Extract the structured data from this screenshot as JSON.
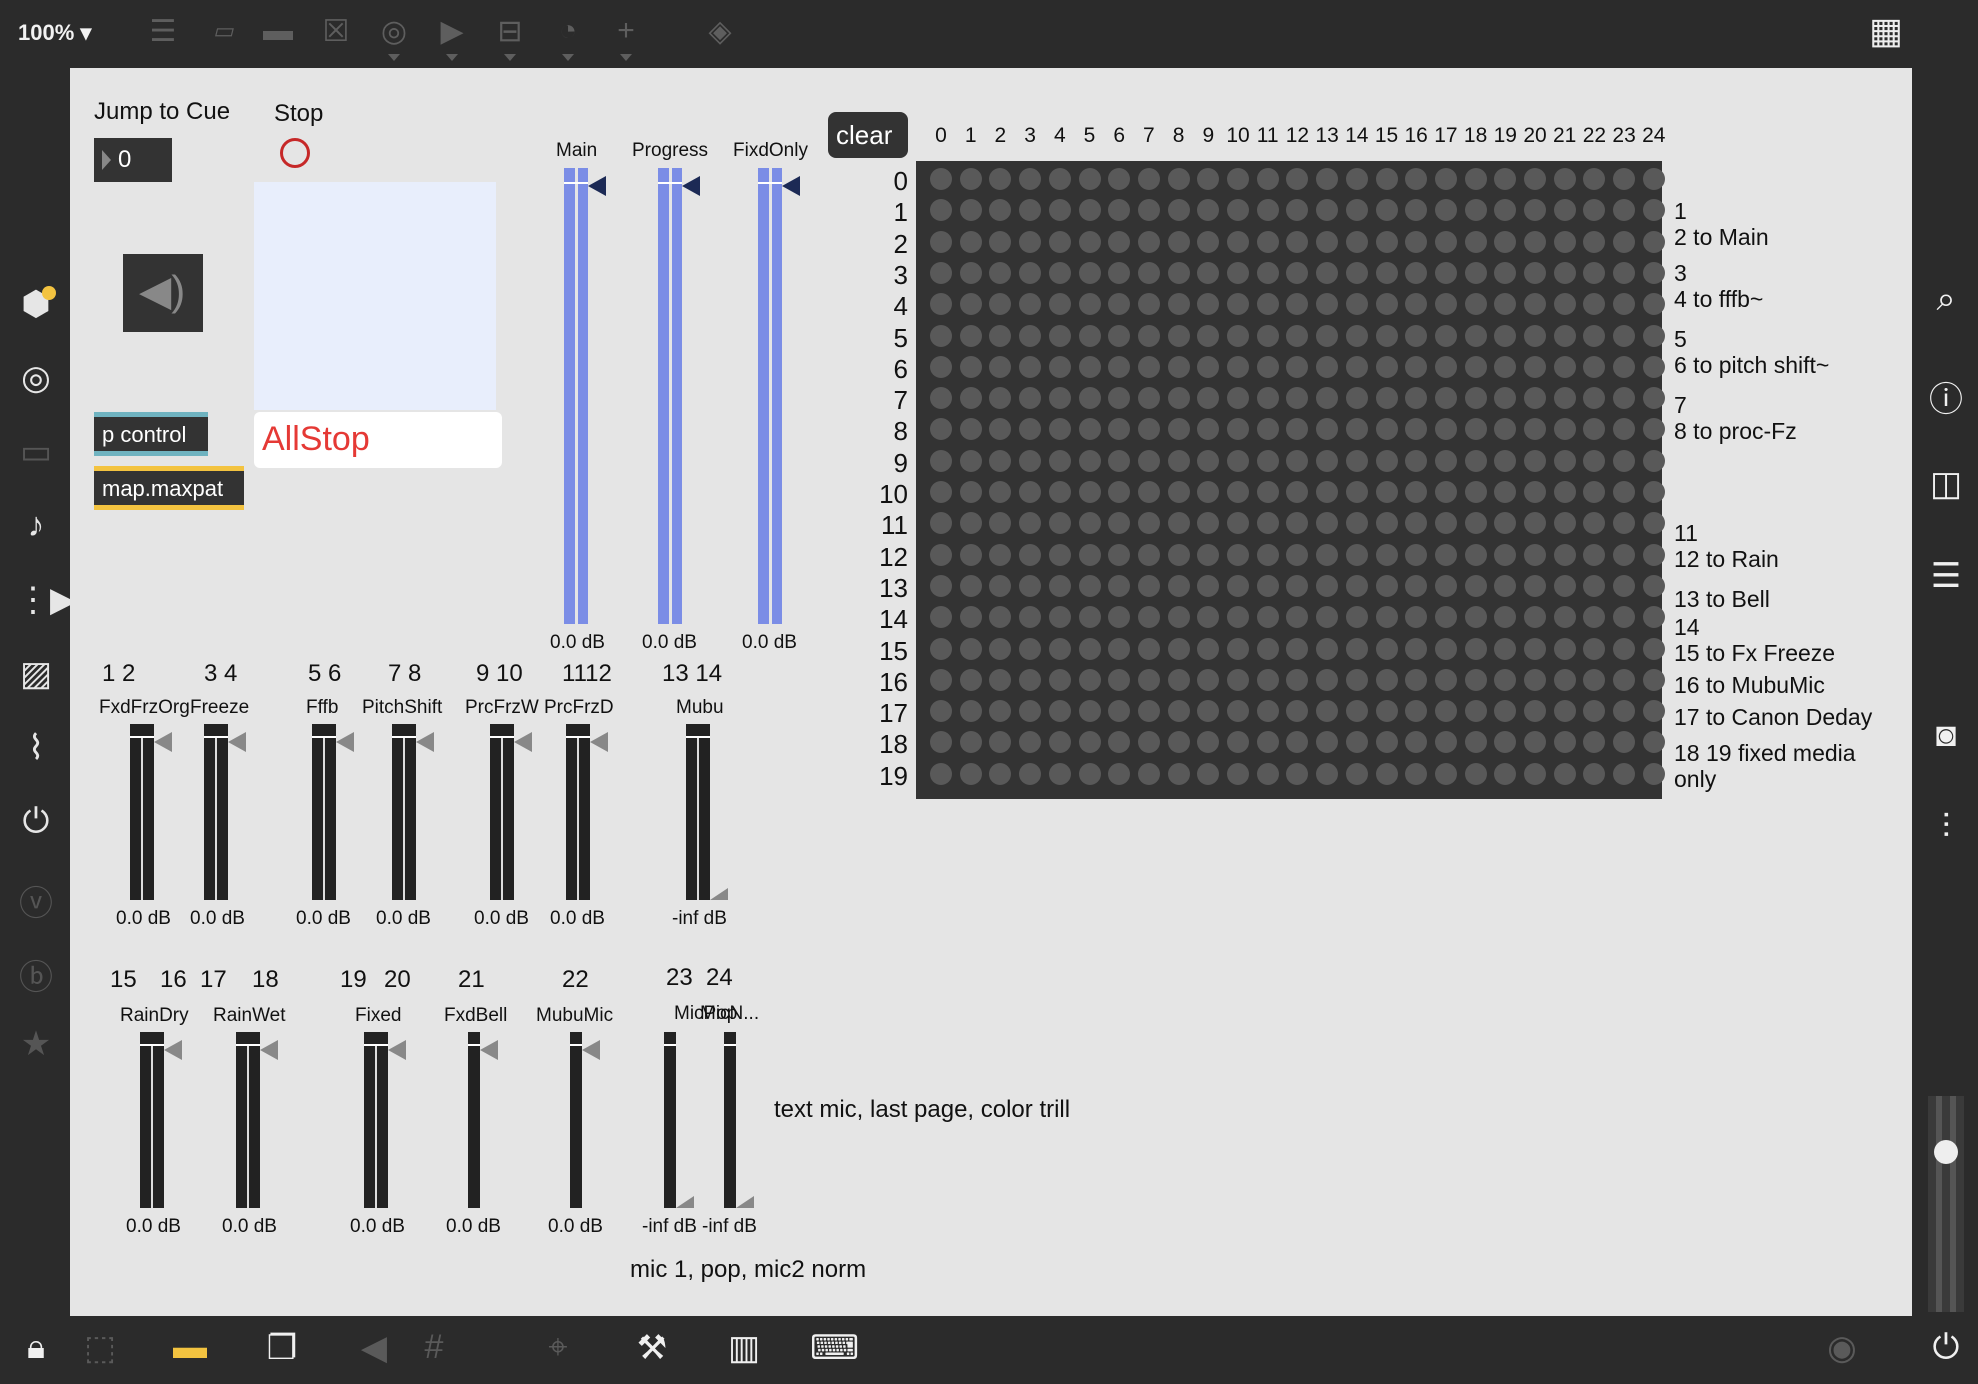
{
  "toolbar": {
    "zoom": "100%",
    "icons": [
      "presentation-icon",
      "message-icon",
      "comment-icon",
      "toggle-icon",
      "button-icon",
      "play-icon",
      "slider-icon",
      "dial-icon",
      "add-icon",
      "paint-bucket-icon",
      "grid-icon"
    ]
  },
  "patch": {
    "jump_label": "Jump to Cue",
    "jump_value": "0",
    "stop_label": "Stop",
    "allstop": "AllStop",
    "p_control": "p control",
    "map_maxpat": "map.maxpat",
    "colors": {
      "allstop_text": "#e53935",
      "p_control_accent": "#6fb3c0",
      "map_accent": "#f3c340",
      "matrix_bg": "#333333"
    },
    "main_meters": [
      {
        "name": "Main",
        "value": "0.0 dB",
        "level": 1.0
      },
      {
        "name": "Progress",
        "value": "0.0 dB",
        "level": 1.0
      },
      {
        "name": "FixdOnly",
        "value": "0.0 dB",
        "level": 1.0
      }
    ],
    "row1_numbers": [
      "1 2",
      "3 4",
      "5  6",
      "7 8",
      "9 10",
      "1112",
      "13  14"
    ],
    "row1_meters": [
      {
        "name": "FxdFrzOrg",
        "value": "0.0 dB",
        "level": 1.0
      },
      {
        "name": "Freeze",
        "value": "0.0 dB",
        "level": 1.0
      },
      {
        "name": "Fffb",
        "value": "0.0 dB",
        "level": 1.0
      },
      {
        "name": "PitchShift",
        "value": "0.0 dB",
        "level": 1.0
      },
      {
        "name": "PrcFrzW",
        "value": "0.0 dB",
        "level": 1.0
      },
      {
        "name": "PrcFrzD",
        "value": "0.0 dB",
        "level": 1.0
      },
      {
        "name": "Mubu",
        "value": "-inf dB",
        "level": 0.0
      }
    ],
    "row2_numbers": [
      "15",
      "16",
      "17",
      "18",
      "19",
      "20",
      "21",
      "22",
      "23",
      "24"
    ],
    "row2_meters": [
      {
        "name": "RainDry",
        "value": "0.0 dB",
        "level": 1.0
      },
      {
        "name": "RainWet",
        "value": "0.0 dB",
        "level": 1.0
      },
      {
        "name": "Fixed",
        "value": "0.0 dB",
        "level": 1.0
      },
      {
        "name": "FxdBell",
        "value": "0.0 dB",
        "level": 1.0
      },
      {
        "name": "MubuMic",
        "value": "0.0 dB",
        "level": 1.0
      },
      {
        "name": "MicPop",
        "value": "-inf dB",
        "level": 0.0
      },
      {
        "name": "MicN...",
        "value": "-inf dB",
        "level": 0.0
      }
    ],
    "comment_1": "text mic, last page, color trill",
    "comment_2": "mic 1, pop, mic2 norm",
    "matrix": {
      "clear": "clear",
      "columns": [
        "0",
        "1",
        "2",
        "3",
        "4",
        "5",
        "6",
        "7",
        "8",
        "9",
        "10",
        "11",
        "12",
        "13",
        "14",
        "15",
        "16",
        "17",
        "18",
        "19",
        "20",
        "21",
        "22",
        "23",
        "24"
      ],
      "rows": [
        "0",
        "1",
        "2",
        "3",
        "4",
        "5",
        "6",
        "7",
        "8",
        "9",
        "10",
        "11",
        "12",
        "13",
        "14",
        "15",
        "16",
        "17",
        "18",
        "19"
      ],
      "labels": [
        "1",
        "2 to Main",
        "3",
        "4  to fffb~",
        "5",
        "6  to pitch shift~",
        "7",
        "8  to proc-Fz",
        "11",
        "12 to Rain",
        "13 to Bell",
        "14",
        "15 to Fx Freeze",
        "16 to MubuMic",
        "17 to Canon Deday",
        "18 19  fixed media",
        "only"
      ]
    }
  },
  "sidebar_left": [
    "package-icon",
    "target-icon",
    "media-icon",
    "music-note-icon",
    "sequence-icon",
    "image-icon",
    "paperclip-icon",
    "plug-icon",
    "v-icon",
    "b-icon",
    "star-icon"
  ],
  "sidebar_right": [
    "search-icon",
    "info-icon",
    "columns-icon",
    "list-settings-icon",
    "camera-icon",
    "mixer-icon"
  ],
  "bottom_bar": [
    "lock-icon",
    "select-icon",
    "comment-mode-icon",
    "windows-icon",
    "mute-icon",
    "grid-icon",
    "pin-add-icon",
    "wrench-icon",
    "piano-icon",
    "keyboard-icon",
    "transport-icon",
    "power-icon"
  ]
}
